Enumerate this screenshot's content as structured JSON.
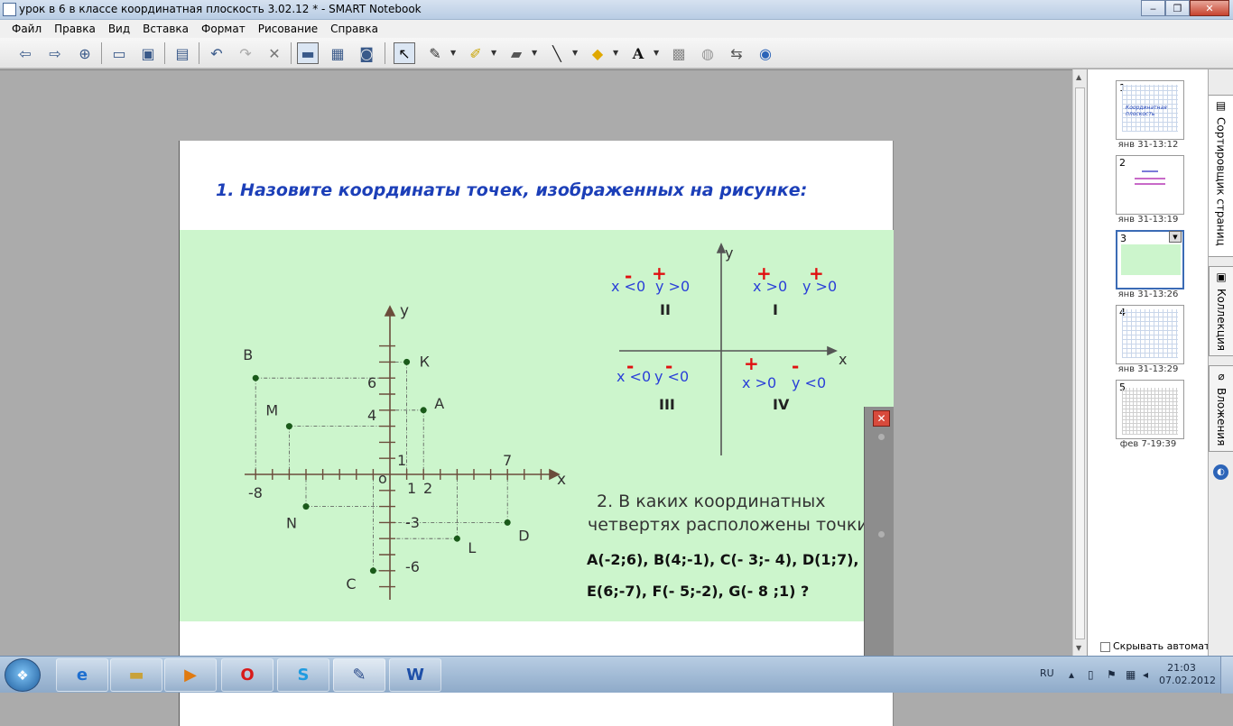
{
  "window": {
    "title": "урок в 6 в классе координатная плоскость 3.02.12 * - SMART Notebook",
    "controls": {
      "minimize": "‒",
      "maximize": "❐",
      "close": "✕"
    }
  },
  "menu": [
    "Файл",
    "Правка",
    "Вид",
    "Вставка",
    "Формат",
    "Рисование",
    "Справка"
  ],
  "slide": {
    "heading": "1. Назовите координаты точек, изображенных на рисунке:",
    "graph1": {
      "axis_x": "x",
      "axis_y": "y",
      "origin": "o",
      "ticks": {
        "six": "6",
        "four": "4",
        "one_y": "1",
        "seven": "7",
        "minus_eight": "-8",
        "one_x": "1",
        "two": "2",
        "minus_three": "-3",
        "minus_six": "-6"
      },
      "points": [
        {
          "label": "К",
          "x": 1,
          "y": 7
        },
        {
          "label": "B",
          "x": -8,
          "y": 6
        },
        {
          "label": "A",
          "x": 2,
          "y": 4
        },
        {
          "label": "M",
          "x": -6,
          "y": 3
        },
        {
          "label": "N",
          "x": -5,
          "y": -2
        },
        {
          "label": "D",
          "x": 7,
          "y": -3
        },
        {
          "label": "L",
          "x": 4,
          "y": -4
        },
        {
          "label": "C",
          "x": -1,
          "y": -6
        }
      ]
    },
    "graph2": {
      "axis_x": "x",
      "axis_y": "y",
      "plus": "+",
      "minus": "-",
      "q1": {
        "roman": "I",
        "x_cond": "x >0",
        "y_cond": "y >0"
      },
      "q2": {
        "roman": "II",
        "x_cond": "x <0",
        "y_cond": "y >0"
      },
      "q3": {
        "roman": "III",
        "x_cond": "x <0",
        "y_cond": "y <0"
      },
      "q4": {
        "roman": "IV",
        "x_cond": "x >0",
        "y_cond": "y <0"
      }
    },
    "task2": {
      "line1": "2.  В каких координатных",
      "line2": "четвертях расположены точки",
      "points_line1": "A(-2;6), B(4;-1), C(- 3;- 4), D(1;7),",
      "points_line2": "E(6;-7), F(- 5;-2), G(- 8 ;1)  ?"
    }
  },
  "sorter": {
    "pages": [
      {
        "num": "1",
        "date": "янв 31-13:12",
        "mini_title": "Координатная плоскость"
      },
      {
        "num": "2",
        "date": "янв 31-13:19"
      },
      {
        "num": "3",
        "date": "янв 31-13:26"
      },
      {
        "num": "4",
        "date": "янв 31-13:29"
      },
      {
        "num": "5",
        "date": "фев 7-19:39"
      }
    ],
    "autohide": "Скрывать автомат"
  },
  "side_tabs": [
    "Сортировщик страниц",
    "Коллекция",
    "Вложения"
  ],
  "taskbar": {
    "lang": "RU",
    "time": "21:03",
    "date": "07.02.2012"
  },
  "colors": {
    "heading": "#1c3fb8",
    "green_area": "#ccf5cc",
    "point": "#1a5a1a",
    "axis": "#6b4c3b",
    "sign": "#e01010",
    "condition": "#2a3fd8"
  }
}
